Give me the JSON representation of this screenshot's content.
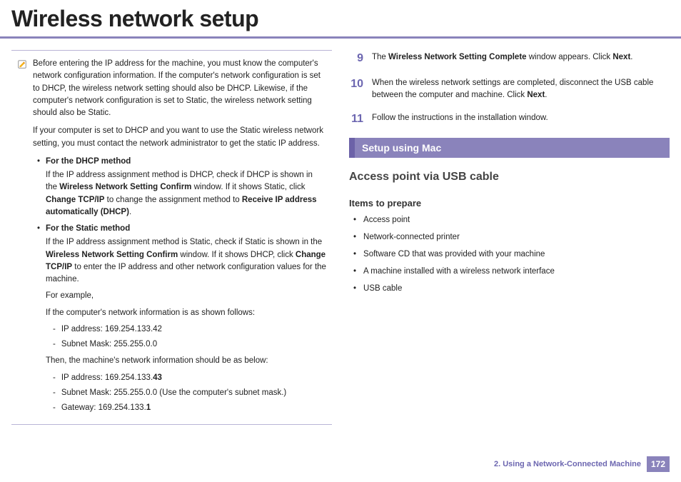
{
  "title": "Wireless network setup",
  "note": {
    "p1a": "Before entering the IP address for the machine, you must know the computer's network configuration information. If the computer's network configuration is set to DHCP, the wireless network setting should also be DHCP. Likewise, if the computer's network configuration is set to Static, the wireless network setting should also be Static.",
    "p1b": "If your computer is set to DHCP and you want to use the Static wireless network setting, you must contact the network administrator to get the static IP address.",
    "dhcp_heading": "For the DHCP method",
    "dhcp_text_a": "If the IP address assignment method is DHCP, check if DHCP is shown in the ",
    "dhcp_text_b": "Wireless Network Setting Confirm",
    "dhcp_text_c": " window. If it shows Static, click ",
    "dhcp_text_d": "Change TCP/IP",
    "dhcp_text_e": " to change the assignment method to ",
    "dhcp_text_f": "Receive IP address automatically (DHCP)",
    "dhcp_text_g": ".",
    "static_heading": "For the Static method",
    "static_text_a": "If the IP address assignment method is Static, check if Static is shown in the ",
    "static_text_b": "Wireless Network Setting Confirm",
    "static_text_c": " window. If it shows DHCP, click ",
    "static_text_d": "Change TCP/IP",
    "static_text_e": " to enter the IP address and other network configuration values for the machine.",
    "example_label": "For example,",
    "example_intro": "If the computer's network information is as shown follows:",
    "ip1": "IP address: 169.254.133.42",
    "mask1": "Subnet Mask: 255.255.0.0",
    "then_label": "Then, the machine's network information should be as below:",
    "ip2a": "IP address: 169.254.133.",
    "ip2b": "43",
    "mask2": "Subnet Mask: 255.255.0.0 (Use the computer's subnet mask.)",
    "gw_a": "Gateway: 169.254.133.",
    "gw_b": "1"
  },
  "steps": {
    "s9": {
      "num": "9",
      "a": "The ",
      "b": "Wireless Network Setting Complete",
      "c": " window appears. Click ",
      "d": "Next",
      "e": "."
    },
    "s10": {
      "num": "10",
      "a": "When the wireless network settings are completed, disconnect the USB cable between the computer and machine. Click ",
      "b": "Next",
      "c": "."
    },
    "s11": {
      "num": "11",
      "a": "Follow the instructions in the installation window."
    }
  },
  "section_bar": "Setup using Mac",
  "h2": "Access point via USB cable",
  "h3": "Items to prepare",
  "items": {
    "i1": "Access point",
    "i2": "Network-connected printer",
    "i3": "Software CD that was provided with your machine",
    "i4": "A machine installed with a wireless network interface",
    "i5": " USB cable"
  },
  "footer": {
    "chapter": "2.  Using a Network-Connected Machine",
    "page": "172"
  }
}
